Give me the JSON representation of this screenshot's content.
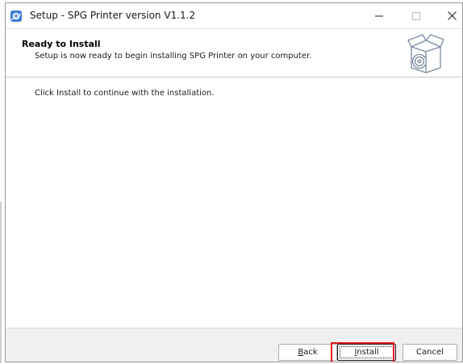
{
  "window": {
    "title": "Setup - SPG Printer version V1.1.2",
    "controls": {
      "minimize": "minimize-icon",
      "maximize": "maximize-icon",
      "close": "close-icon"
    }
  },
  "header": {
    "title": "Ready to Install",
    "subtitle": "Setup is now ready to begin installing SPG Printer on your computer.",
    "graphic": "install-box-icon"
  },
  "content": {
    "message": "Click Install to continue with the installation."
  },
  "footer": {
    "back": {
      "accel": "B",
      "rest": "ack"
    },
    "install": {
      "accel": "I",
      "rest": "nstall"
    },
    "cancel": "Cancel"
  },
  "colors": {
    "highlight": "#e0141e",
    "background": "#f0f0f0",
    "panel": "#ffffff"
  }
}
